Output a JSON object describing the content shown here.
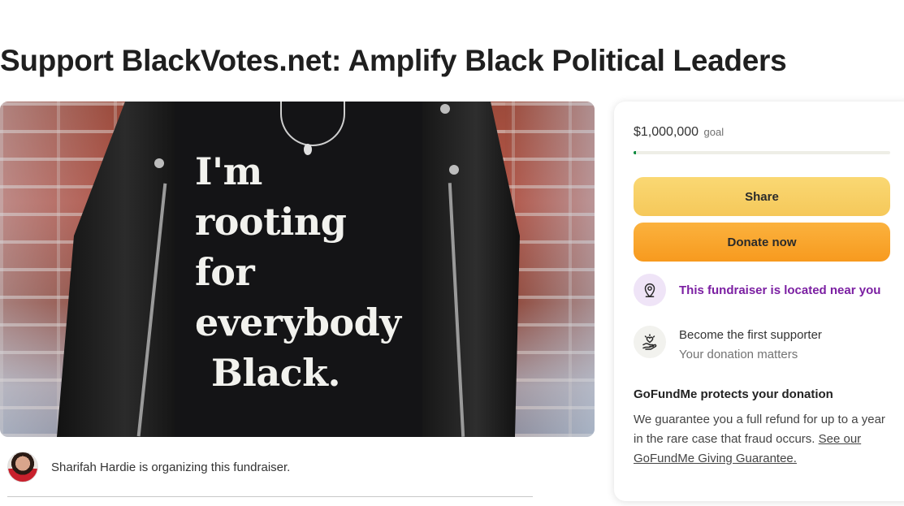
{
  "page": {
    "title": "Support BlackVotes.net: Amplify Black Political Leaders"
  },
  "hero": {
    "shirt_lines": [
      "I'm",
      "rooting",
      "for",
      "everybody",
      "Black."
    ]
  },
  "organizer": {
    "text": "Sharifah Hardie is organizing this fundraiser."
  },
  "donation": {
    "goal_amount": "$1,000,000",
    "goal_label": "goal",
    "progress_fraction": 0.01,
    "share_label": "Share",
    "donate_label": "Donate now",
    "near_text": "This fundraiser is located near you",
    "first_title": "Become the first supporter",
    "first_sub": "Your donation matters",
    "protect_title": "GoFundMe protects your donation",
    "protect_body": "We guarantee you a full refund for up to a year in the rare case that fraud occurs.",
    "protect_link": "See our GoFundMe Giving Guarantee."
  },
  "colors": {
    "share_button": "#f5c85a",
    "donate_button": "#f79a1e",
    "near_text": "#7b1fa2",
    "progress_fill": "#0b8a3f"
  },
  "icons": {
    "location": "map-pin-icon",
    "supporter": "hand-heart-icon"
  }
}
